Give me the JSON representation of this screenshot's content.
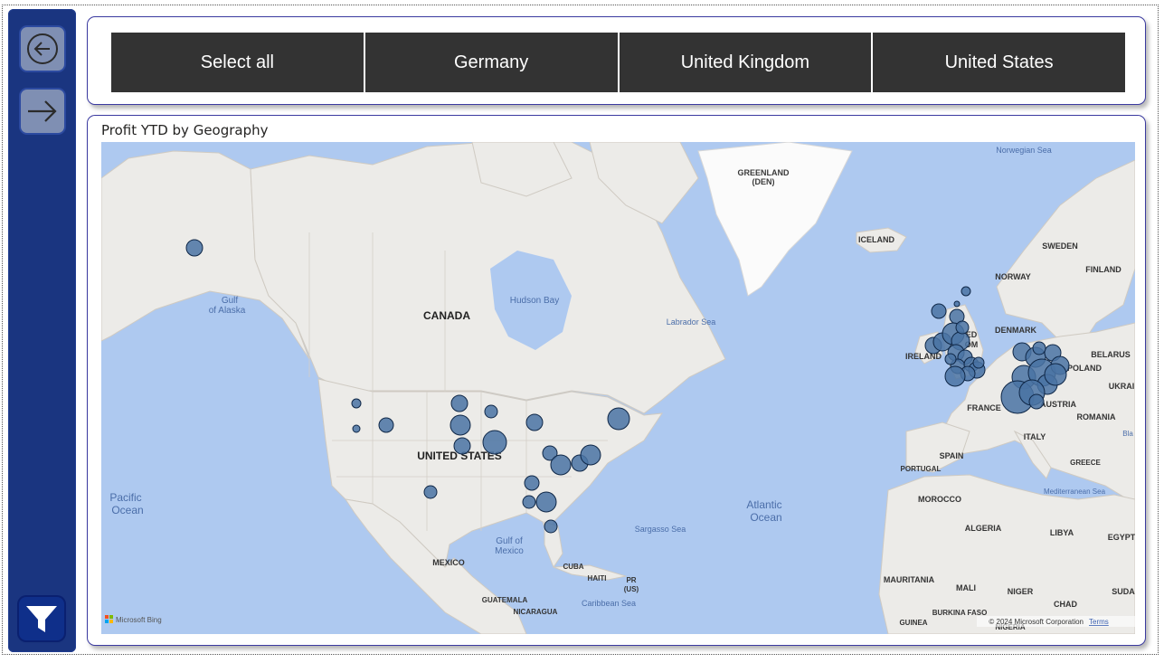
{
  "navigation": {
    "back_icon": "arrow-left-circle-icon",
    "forward_icon": "arrow-right-icon",
    "filter_icon": "funnel-icon"
  },
  "slicer": {
    "options": [
      "Select all",
      "Germany",
      "United Kingdom",
      "United States"
    ]
  },
  "map_visual": {
    "title": "Profit YTD by Geography",
    "labels": {
      "greenland": "GREENLAND",
      "greenland_sub": "(DEN)",
      "canada": "CANADA",
      "united_states": "UNITED STATES",
      "mexico": "MEXICO",
      "iceland": "ICELAND",
      "sweden": "SWEDEN",
      "finland": "FINLAND",
      "norway": "NORWAY",
      "denmark": "DENMARK",
      "ireland": "IRELAND",
      "belarus": "BELARUS",
      "poland": "POLAND",
      "ukraine": "UKRAI",
      "austria": "AUSTRIA",
      "france": "FRANCE",
      "romania": "ROMANIA",
      "italy": "ITALY",
      "spain": "SPAIN",
      "portugal": "PORTUGAL",
      "greece": "GREECE",
      "morocco": "MOROCCO",
      "algeria": "ALGERIA",
      "libya": "LIBYA",
      "egypt": "EGYPT",
      "mauritania": "MAURITANIA",
      "mali": "MALI",
      "niger": "NIGER",
      "chad": "CHAD",
      "sudan": "SUDA",
      "burkina": "BURKINA FASO",
      "guinea": "GUINEA",
      "nigeria": "NIGERIA",
      "cuba": "CUBA",
      "haiti": "HAITI",
      "pr": "PR",
      "pr_sub": "(US)",
      "guatemala": "GUATEMALA",
      "nicaragua": "NICARAGUA",
      "gulf_alaska_1": "Gulf",
      "gulf_alaska_2": "of Alaska",
      "hudson_bay": "Hudson Bay",
      "labrador_sea": "Labrador Sea",
      "pacific_1": "Pacific",
      "pacific_2": "Ocean",
      "atlantic_1": "Atlantic",
      "atlantic_2": "Ocean",
      "sargasso": "Sargasso Sea",
      "gulf_mexico_1": "Gulf of",
      "gulf_mexico_2": "Mexico",
      "caribbean": "Caribbean Sea",
      "norwegian_sea": "Norwegian Sea",
      "mediterranean": "Mediterranean Sea",
      "united_kingdom_partial": "ED",
      "united_kingdom_partial2": "OM",
      "bla": "Bla"
    },
    "attribution": {
      "bing": "Microsoft Bing",
      "copyright": "© 2024 Microsoft Corporation",
      "terms": "Terms"
    }
  }
}
